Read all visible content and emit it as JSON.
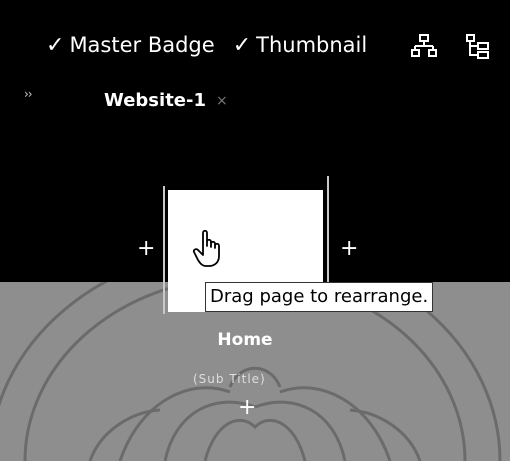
{
  "toolbar": {
    "master_badge_label": "Master Badge",
    "thumbnail_label": "Thumbnail",
    "sitemap_icon": "sitemap-icon",
    "tree_icon": "tree-view-icon"
  },
  "tab": {
    "label": "Website-1",
    "close_glyph": "×",
    "collapse_glyph": "››"
  },
  "canvas": {
    "page_label": "Home",
    "page_sublabel": "(Sub Title)",
    "add_glyph": "+",
    "tooltip": "Drag page to rearrange."
  },
  "colors": {
    "top_bg": "#000000",
    "bottom_bg": "#8e8e8e",
    "card": "#ffffff"
  }
}
